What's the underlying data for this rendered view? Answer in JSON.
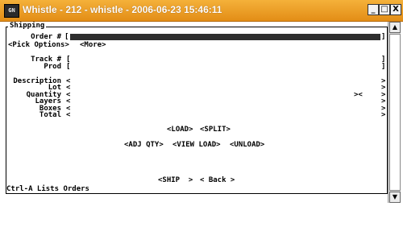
{
  "window": {
    "title": "Whistle - 212 - whistle - 2006-06-23 15:46:11",
    "icon_label": "GN",
    "minimize_glyph": "_",
    "maximize_glyph": "□",
    "close_glyph": "X"
  },
  "form": {
    "section_title": "Shipping",
    "footer": "Ctrl-A Lists Orders",
    "order_label": "Order #",
    "order_value": "",
    "pick_options": "<Pick Options>",
    "more": "<More>",
    "track_label": "Track #",
    "prod_label": "Prod",
    "description_label": "Description",
    "lot_label": "Lot",
    "quantity_label": "Quantity",
    "layers_label": "Layers",
    "boxes_label": "Boxes",
    "total_label": "Total",
    "quantity_mid_marker": "><"
  },
  "actions": {
    "load": "<LOAD>",
    "split": "<SPLIT>",
    "adj_qty": "<ADJ QTY>",
    "view_load": "<VIEW LOAD>",
    "unload": "<UNLOAD>",
    "ship": "<SHIP  >",
    "back": "< Back >"
  },
  "scrollbar": {
    "up_glyph": "▲",
    "down_glyph": "▼"
  },
  "brackets": {
    "open_square": "[",
    "close_square": "]",
    "open_angle": "<",
    "close_angle": ">"
  }
}
